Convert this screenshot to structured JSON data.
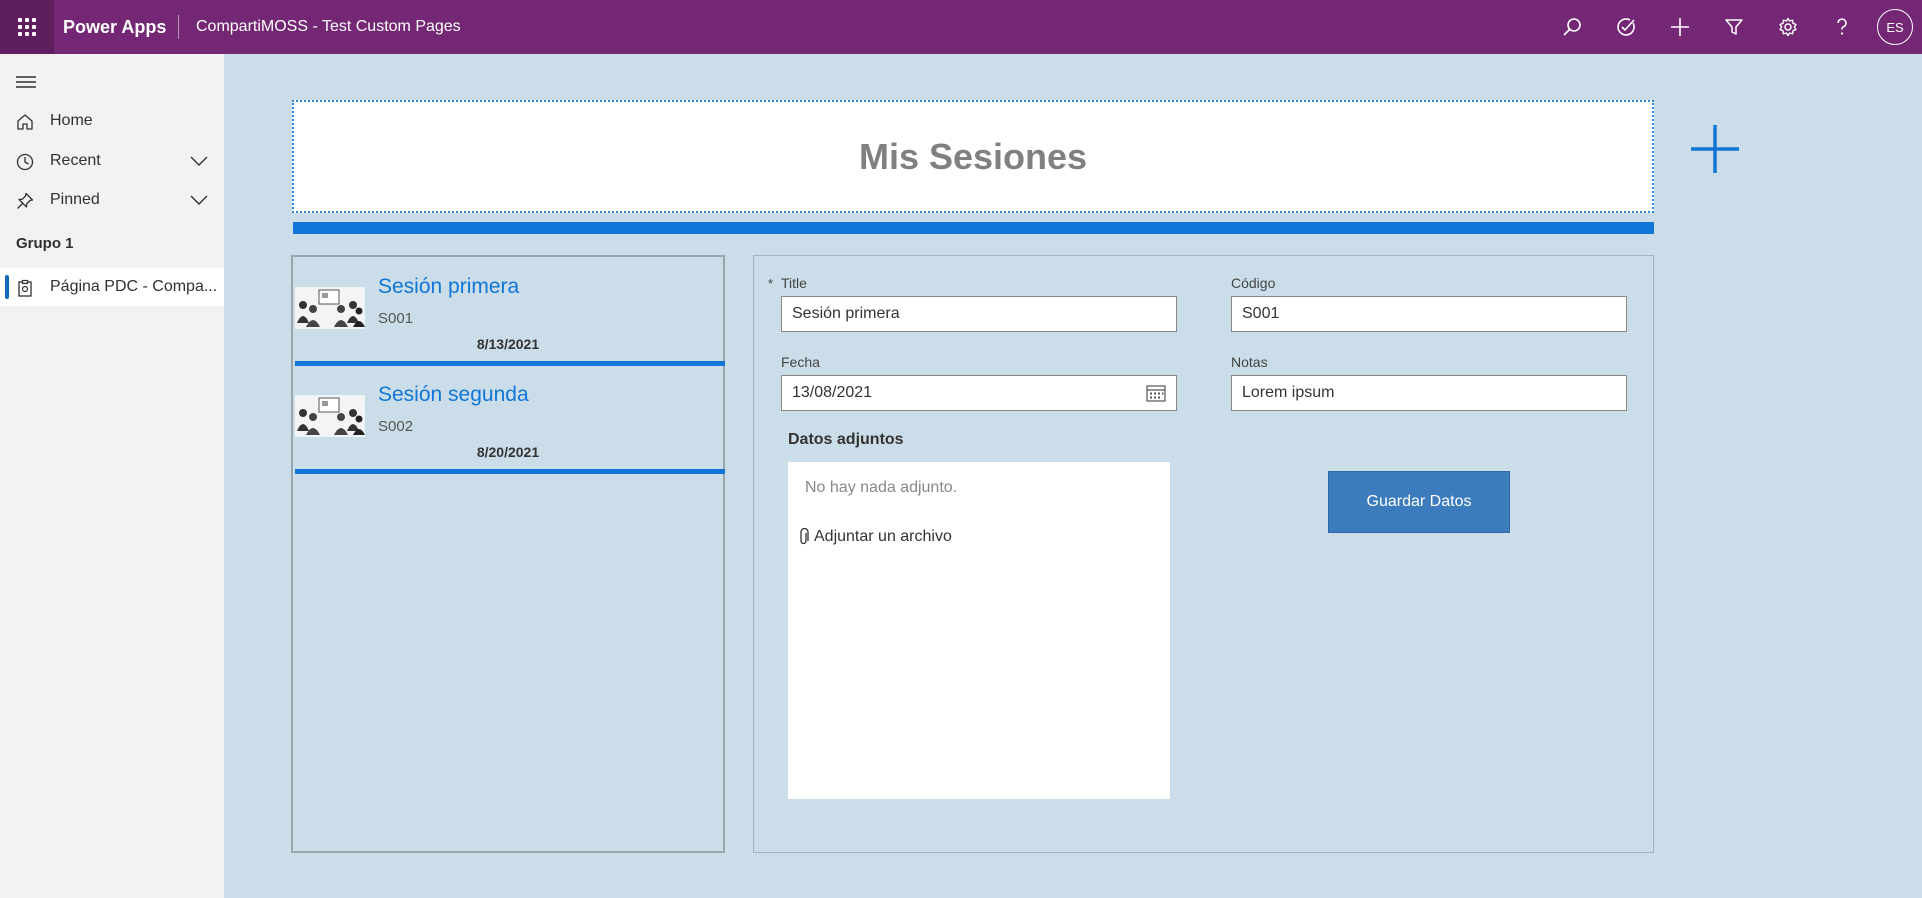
{
  "topbar": {
    "brand": "Power Apps",
    "app_title": "CompartiMOSS - Test Custom Pages",
    "avatar_initials": "ES",
    "icons": [
      "search-icon",
      "assistant-icon",
      "add-icon",
      "filter-icon",
      "settings-icon",
      "help-icon"
    ]
  },
  "sidebar": {
    "items": [
      {
        "label": "Home",
        "icon": "home-icon"
      },
      {
        "label": "Recent",
        "icon": "clock-icon"
      },
      {
        "label": "Pinned",
        "icon": "pin-icon"
      }
    ],
    "group": "Grupo 1",
    "active_item": {
      "label": "Página PDC - Compa...",
      "icon": "page-icon"
    }
  },
  "header": {
    "title": "Mis Sesiones"
  },
  "gallery": {
    "items": [
      {
        "title": "Sesión primera",
        "code": "S001",
        "date": "8/13/2021"
      },
      {
        "title": "Sesión segunda",
        "code": "S002",
        "date": "8/20/2021"
      }
    ]
  },
  "form": {
    "title_label": "Title",
    "required_mark": "*",
    "title_value": "Sesión primera",
    "codigo_label": "Código",
    "codigo_value": "S001",
    "fecha_label": "Fecha",
    "fecha_value": "13/08/2021",
    "notas_label": "Notas",
    "notas_value": "Lorem ipsum",
    "attachments_label": "Datos adjuntos",
    "attachments_empty": "No hay nada adjunto.",
    "attach_link": "Adjuntar un archivo",
    "save_button": "Guardar Datos"
  },
  "colors": {
    "topbar": "#742774",
    "canvas": "#cbdde9",
    "accent": "#0f76d8",
    "button": "#3c7bbc"
  }
}
